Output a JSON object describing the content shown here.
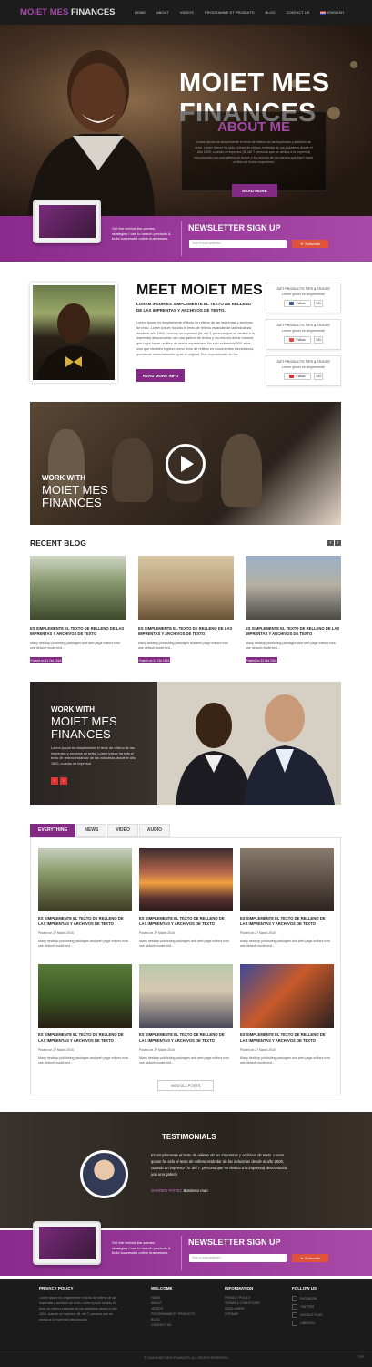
{
  "nav": {
    "logo_a": "MOIET MES",
    "logo_b": "FINANCES",
    "items": [
      "HOME",
      "ABOUT",
      "VIDEOS",
      "PROGRAMME ET PRODUITS",
      "BLOG",
      "CONTACT US"
    ],
    "lang": "ENGLISH"
  },
  "hero": {
    "title_line1": "MOIET MES",
    "title_line2": "FINANCES",
    "about_title": "ABOUT ME",
    "about_text": "Lorem ipsum es simplemente el texto de relleno de las imprentas y archivos de texto. Lorem Ipsum ha sido el texto de relleno estándar de las industrias desde el año 1500, cuando un impresor (N. del T. persona que se dedica a la imprenta) desconocido usó una galería de textos y los mezcló de tal manera que logró hacer un libro de textos especimen.",
    "read_more": "READ MORE"
  },
  "newsletter": {
    "pitch": "Get the behind-the-scenes strategies I use to launch products & build successful online businesses.",
    "title": "NEWSLETTER SIGN UP",
    "placeholder": "Your e-mail address...",
    "subscribe": "Subscribe"
  },
  "meet": {
    "title": "MEET MOIET MES",
    "subtitle": "LOREM IPSUM ES SIMPLEMENTE EL TEXTO DE RELLENO DE LAS IMPRENTAS Y ARCHIVOS DE TEXTO.",
    "text": "Lorem Ipsum es simplemente el texto de relleno de las imprentas y archivos de texto. Lorem Ipsum ha sido el texto de relleno estándar de las industrias desde el año 1500, cuando un impresor (N. del T. persona que se dedica a la imprenta) desconocido usó una galería de textos y los mezcló de tal manera que logró hacer un libro de textos especimen. No sólo sobrevivió 500 años, sino que tambien ingresó como texto de relleno en documentos electrónicos, quedando esencialmente igual al original. Fue popularizado en los...",
    "read_more": "READ MORE INFO"
  },
  "promo_boxes": [
    {
      "title": "GET PRODUCTS TIPS & TRICKS",
      "sub": "Lorem Ipsum es simplemente",
      "btn": "Follow",
      "count": "331",
      "color": "#3b5998"
    },
    {
      "title": "GET PRODUCTS TIPS & TRICKS",
      "sub": "Lorem Ipsum es simplemente",
      "btn": "Follow",
      "count": "331",
      "color": "#dd4b39"
    },
    {
      "title": "GET PRODUCTS TIPS & TRICKS",
      "sub": "Lorem Ipsum es simplemente",
      "btn": "Follow",
      "count": "331",
      "color": "#e52d27"
    }
  ],
  "video": {
    "work_with": "WORK WITH",
    "name": "MOIET MES FINANCES"
  },
  "recent_blog": {
    "title": "RECENT BLOG",
    "posts": [
      {
        "title": "ES SIMPLEMENTE EL TEXTO DE RELLENO DE LAS IMPRENTAS Y ARCHIVOS DE TEXTO",
        "text": "Many desktop publishing packages and web page editors now use default model text...",
        "date": "Posted on 24 Oct 2016"
      },
      {
        "title": "ES SIMPLEMENTE EL TEXTO DE RELLENO DE LAS IMPRENTAS Y ARCHIVOS DE TEXTO",
        "text": "Many desktop publishing packages and web page editors now use default model text...",
        "date": "Posted on 24 Oct 2016"
      },
      {
        "title": "ES SIMPLEMENTE EL TEXTO DE RELLENO DE LAS IMPRENTAS Y ARCHIVOS DE TEXTO",
        "text": "Many desktop publishing packages and web page editors now use default model text...",
        "date": "Posted on 24 Oct 2016"
      }
    ]
  },
  "work2": {
    "work_with": "WORK WITH",
    "name": "MOIET MES FINANCES",
    "text": "Lorem ipsum es simplemente el texto de relleno de las imprentas y archivos de texto. Lorem Ipsum ha sido el texto de relleno estándar de las industrias desde el año 1500, cuando un impresor"
  },
  "tabs": {
    "items": [
      "EVERYTHING",
      "NEWS",
      "VIDEO",
      "AUDIO"
    ],
    "active": "EVERYTHING",
    "view_all": "VIEW ALL POSTS",
    "posts": [
      {
        "title": "ES SIMPLEMENTE EL TEXTO DE RELLENO DE LAS IMPRENTAS Y ARCHIVOS DE TEXTO",
        "date": "Posted on 27 March 2016",
        "text": "Many desktop publishing packages and web page editors now use default model text..."
      },
      {
        "title": "ES SIMPLEMENTE EL TEXTO DE RELLENO DE LAS IMPRENTAS Y ARCHIVOS DE TEXTO",
        "date": "Posted on 27 March 2016",
        "text": "Many desktop publishing packages and web page editors now use default model text..."
      },
      {
        "title": "ES SIMPLEMENTE EL TEXTO DE RELLENO DE LAS IMPRENTAS Y ARCHIVOS DE TEXTO",
        "date": "Posted on 27 March 2016",
        "text": "Many desktop publishing packages and web page editors now use default model text..."
      },
      {
        "title": "ES SIMPLEMENTE EL TEXTO DE RELLENO DE LAS IMPRENTAS Y ARCHIVOS DE TEXTO",
        "date": "Posted on 27 March 2016",
        "text": "Many desktop publishing packages and web page editors now use default model text..."
      },
      {
        "title": "ES SIMPLEMENTE EL TEXTO DE RELLENO DE LAS IMPRENTAS Y ARCHIVOS DE TEXTO",
        "date": "Posted on 27 March 2016",
        "text": "Many desktop publishing packages and web page editors now use default model text..."
      },
      {
        "title": "ES SIMPLEMENTE EL TEXTO DE RELLENO DE LAS IMPRENTAS Y ARCHIVOS DE TEXTO",
        "date": "Posted on 27 March 2016",
        "text": "Many desktop publishing packages and web page editors now use default model text..."
      }
    ]
  },
  "testimonials": {
    "title": "TESTIMONIALS",
    "quote": "Es simplemente el texto de relleno de las imprentas y archivos de texto. Lorem Ipsum ha sido el texto de relleno estándar de las industrias desde el año 1500, cuando un impresor (N. del T. persona que se dedica a la imprenta) desconocido usó una galería",
    "author": "DARREN PATRIC",
    "role": "Business man"
  },
  "footer": {
    "privacy_title": "PRIVACY POLICY",
    "privacy_text": "Lorem Ipsum es simplemente el texto de relleno de las imprentas y archivos de texto. Lorem Ipsum ha sido el texto de relleno estándar de las industrias desde el año 1500, cuando un impresor (N. del T. persona que se dedica a la imprenta) desconocido",
    "welcome_title": "WELCOME",
    "welcome_links": [
      "HOME",
      "ABOUT",
      "VIDEOS",
      "PROGRAMME ET PRODUITS",
      "BLOG",
      "CONTACT US"
    ],
    "info_title": "INFORMATION",
    "info_links": [
      "PRIVACY POLICY",
      "TERMS & CONDITIONS",
      "DISCLAIMER",
      "SITEMAP"
    ],
    "follow_title": "FOLLOW US",
    "follow_links": [
      "FACEBOOK",
      "TWITTER",
      "GOOGLE PLUS",
      "LINKEDIN"
    ],
    "copyright": "© 2016 MOIET MES FINANCES. ALL RIGHTS RESERVED",
    "top": "TOP"
  },
  "colors": {
    "brand": "#822a84",
    "accent": "#e0533a",
    "dark": "#1b1b1b"
  }
}
